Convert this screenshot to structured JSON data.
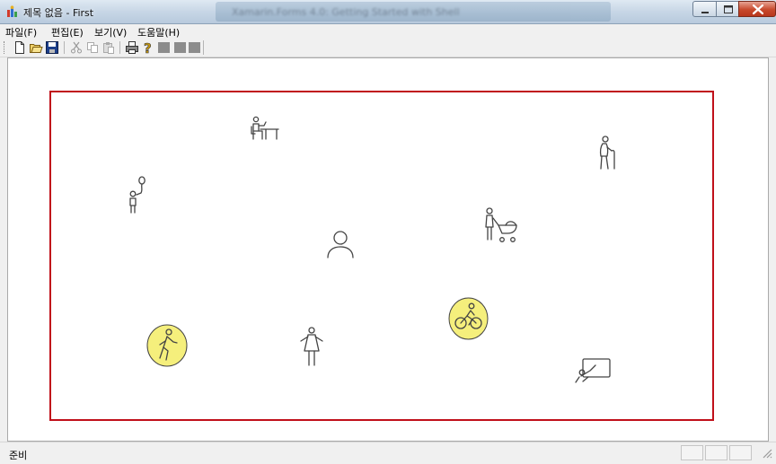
{
  "window": {
    "title": "제목 없음 - First",
    "background_title": "Xamarin.Forms 4.0: Getting Started with Shell"
  },
  "menu": {
    "items": [
      "파일(F)",
      "편집(E)",
      "보기(V)",
      "도움말(H)"
    ]
  },
  "toolbar": {
    "buttons": [
      "new-icon",
      "open-icon",
      "save-icon",
      "cut-icon",
      "copy-icon",
      "paste-icon",
      "print-icon",
      "help-icon",
      "blank-icon",
      "blank-icon",
      "blank-icon"
    ]
  },
  "canvas": {
    "frame_color": "#c0101a",
    "highlight_color": "#f5ef7c",
    "figures": [
      {
        "name": "person-at-desk-icon",
        "highlighted": false
      },
      {
        "name": "elderly-person-icon",
        "highlighted": false
      },
      {
        "name": "child-with-balloon-icon",
        "highlighted": false
      },
      {
        "name": "person-with-stroller-icon",
        "highlighted": false
      },
      {
        "name": "person-outline-icon",
        "highlighted": false
      },
      {
        "name": "cyclist-icon",
        "highlighted": true
      },
      {
        "name": "pedestrian-icon",
        "highlighted": true
      },
      {
        "name": "woman-icon",
        "highlighted": false
      },
      {
        "name": "presenter-board-icon",
        "highlighted": false
      }
    ]
  },
  "status": {
    "text": "준비"
  }
}
